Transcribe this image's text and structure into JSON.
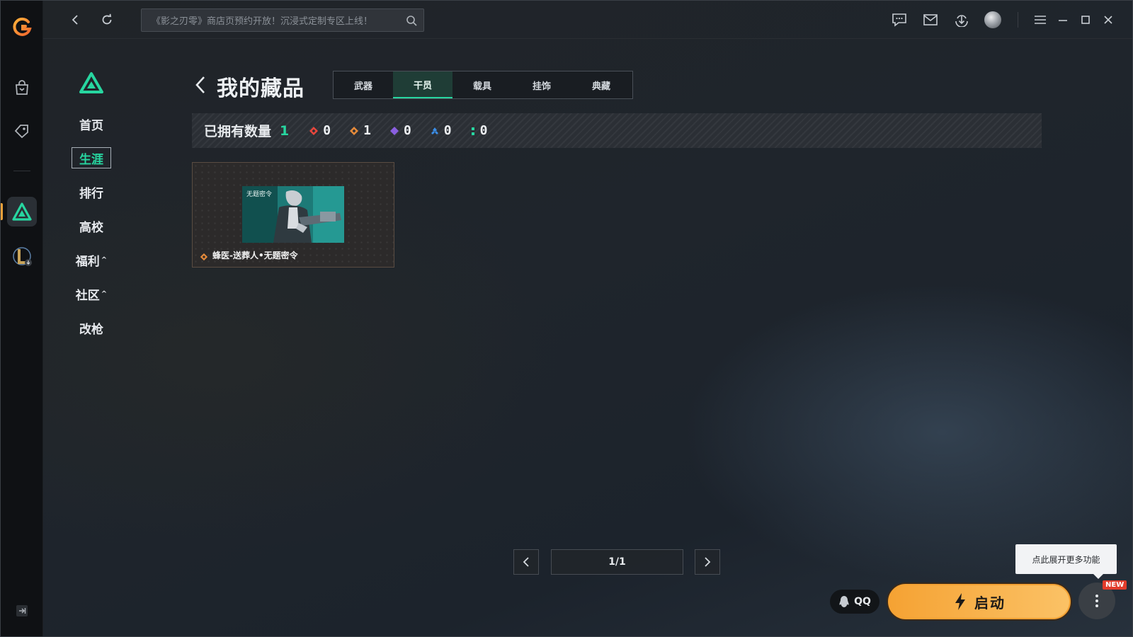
{
  "titlebar": {
    "search_placeholder": "《影之刃零》商店页预约开放！沉浸式定制专区上线！",
    "icons": [
      "back-icon",
      "refresh-icon",
      "search-icon",
      "chat-icon",
      "mail-icon",
      "download-icon",
      "avatar",
      "menu-icon",
      "minimize-icon",
      "maximize-icon",
      "close-icon"
    ]
  },
  "rail": {
    "icons": [
      "app-logo-icon",
      "store-bag-icon",
      "tag-icon",
      "game-delta-icon",
      "game-lol-icon",
      "collapse-icon"
    ]
  },
  "subnav": {
    "items": [
      {
        "label": "首页",
        "active": false
      },
      {
        "label": "生涯",
        "active": true
      },
      {
        "label": "排行",
        "active": false
      },
      {
        "label": "高校",
        "active": false
      },
      {
        "label": "福利",
        "active": false,
        "caret": "^"
      },
      {
        "label": "社区",
        "active": false,
        "caret": "^"
      },
      {
        "label": "改枪",
        "active": false
      }
    ]
  },
  "main": {
    "title": "我的藏品",
    "tabs": [
      {
        "label": "武器",
        "active": false
      },
      {
        "label": "干员",
        "active": true
      },
      {
        "label": "载具",
        "active": false
      },
      {
        "label": "挂饰",
        "active": false
      },
      {
        "label": "典藏",
        "active": false
      }
    ],
    "owned_label": "已拥有数量",
    "owned_count": "1",
    "rarity_counts": [
      {
        "color": "#e8473d",
        "count": "0"
      },
      {
        "color": "#e58a3a",
        "count": "1"
      },
      {
        "color": "#8a5fe0",
        "count": "0"
      },
      {
        "color": "#3b8ee8",
        "count": "0"
      },
      {
        "color": "#27d6a0",
        "count": "0"
      }
    ],
    "items": [
      {
        "name": "蜂医-送葬人•无题密令",
        "art_caption": "无题密令",
        "rarity_color": "#e58a3a"
      }
    ],
    "pagination": {
      "display": "1/1"
    }
  },
  "footer": {
    "tooltip": "点此展开更多功能",
    "qq_label": "QQ",
    "launch_label": "启动",
    "new_badge": "NEW"
  },
  "colors": {
    "accent": "#27d6a0",
    "launch": "#f5a233"
  }
}
